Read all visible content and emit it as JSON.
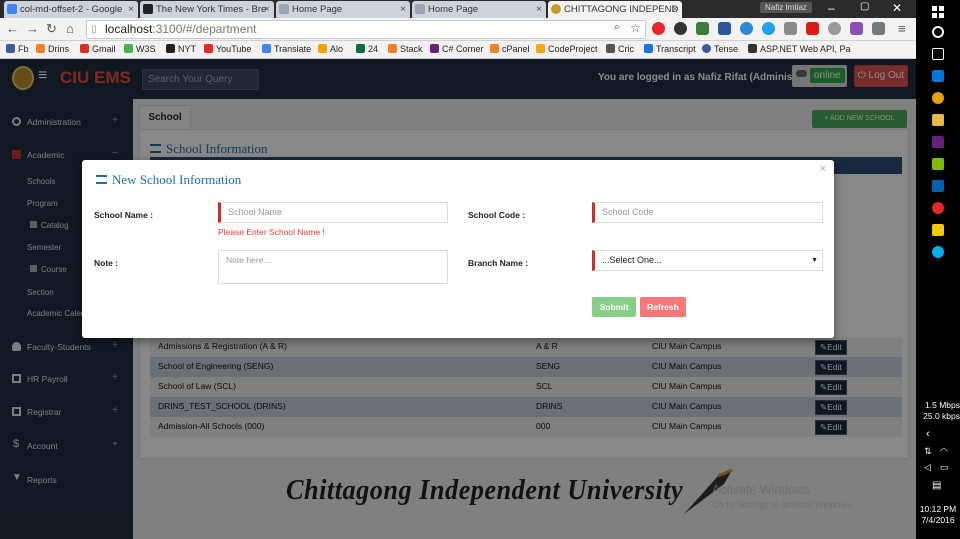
{
  "browser": {
    "tabs": [
      {
        "title": "col-md-offset-2 - Google",
        "color": "#4285f4"
      },
      {
        "title": "The New York Times - Bre",
        "color": "#222222"
      },
      {
        "title": "Home Page",
        "color": "#9aa7b3"
      },
      {
        "title": "Home Page",
        "color": "#9aa7b3"
      },
      {
        "title": "CHITTAGONG INDEPEND",
        "color": "#c79a2b"
      }
    ],
    "user_badge": "Nafiz Imtiaz",
    "url_host": "localhost",
    "url_path": ":3100/#/department",
    "bookmarks": [
      "Fb",
      "Drins",
      "Gmail",
      "W3S",
      "NYT",
      "YouTube",
      "Translate",
      "Alo",
      "24",
      "Stack",
      "C# Corner",
      "cPanel",
      "CodeProject",
      "Cric",
      "Transcript",
      "Tense",
      "ASP.NET Web API, Pa"
    ]
  },
  "header": {
    "brand": "CIU EMS",
    "search_placeholder": "Search Your Query",
    "logged_in_text": "You are logged in as Nafiz Rifat (Administrator)",
    "online_label": "online",
    "logout_label": "Log Out"
  },
  "sidebar": {
    "items": [
      {
        "label": "Administration",
        "icon": "gears-icon"
      },
      {
        "label": "Academic",
        "icon": "book-icon"
      },
      {
        "label": "Faculty-Students",
        "icon": "users-icon"
      },
      {
        "label": "HR Payroll",
        "icon": "payroll-icon"
      },
      {
        "label": "Registrar",
        "icon": "registrar-icon"
      },
      {
        "label": "Account",
        "icon": "dollar-icon"
      },
      {
        "label": "Reports",
        "icon": "filter-icon"
      }
    ],
    "academic_sub": [
      "Schools",
      "Program",
      "Catalog",
      "Semester",
      "Course",
      "Section",
      "Academic Calendar"
    ]
  },
  "content": {
    "tab_label": "School",
    "add_button": "+ ADD NEW SCHOOL",
    "panel_title": "School Information",
    "rows": [
      {
        "name": "Admissions & Registration (A & R)",
        "code": "A & R",
        "branch": "CIU Main Campus",
        "action": "Edit"
      },
      {
        "name": "School of Engineering (SENG)",
        "code": "SENG",
        "branch": "CIU Main Campus",
        "action": "Edit"
      },
      {
        "name": "School of Law (SCL)",
        "code": "SCL",
        "branch": "CIU Main Campus",
        "action": "Edit"
      },
      {
        "name": "DRINS_TEST_SCHOOL (DRINS)",
        "code": "DRINS",
        "branch": "CIU Main Campus",
        "action": "Edit"
      },
      {
        "name": "Admission-All Schools (000)",
        "code": "000",
        "branch": "CIU Main Campus",
        "action": "Edit"
      }
    ],
    "banner": "Chittagong Independent University"
  },
  "modal": {
    "title": "New School Information",
    "close": "×",
    "school_name_label": "School Name :",
    "school_name_placeholder": "School Name",
    "school_name_error": "Please Enter School Name !",
    "school_code_label": "School Code :",
    "school_code_placeholder": "School Code",
    "note_label": "Note :",
    "note_placeholder": "Note here...",
    "branch_label": "Branch Name :",
    "branch_selected": "...Select One...",
    "submit": "Submit",
    "refresh": "Refresh"
  },
  "watermark": {
    "line1": "Activate Windows",
    "line2": "Go to Settings to activate Windows."
  },
  "taskbar": {
    "net_down": "1.5 Mbps",
    "net_up": "25.0 kbps",
    "time": "10:12 PM",
    "date": "7/4/2016"
  }
}
